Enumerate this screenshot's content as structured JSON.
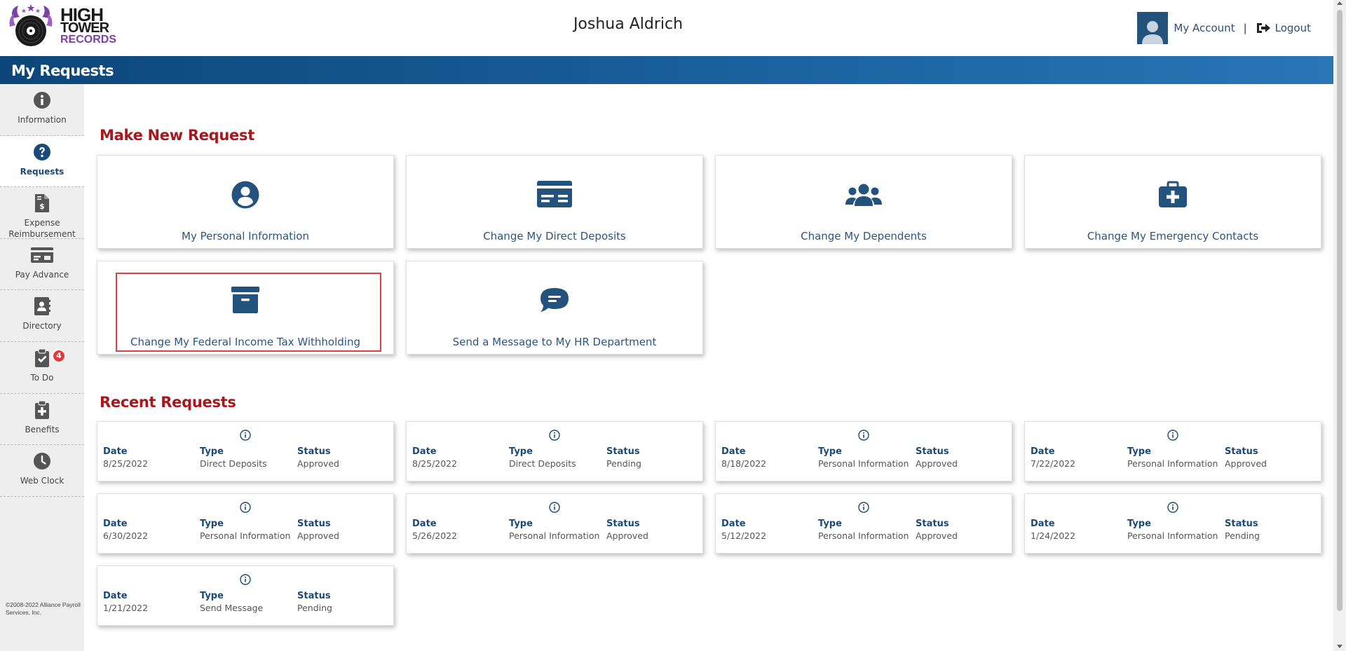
{
  "header": {
    "logo": {
      "line1": "HIGH",
      "line2": "TOWER",
      "line3": "RECORDS"
    },
    "user_name": "Joshua Aldrich",
    "my_account": "My Account",
    "separator": "|",
    "logout": "Logout"
  },
  "page_title": "My Requests",
  "sidebar": {
    "items": [
      {
        "label": "Information",
        "icon": "info-circle-icon"
      },
      {
        "label": "Requests",
        "icon": "question-circle-icon",
        "active": true
      },
      {
        "label": "Expense Reimbursement",
        "icon": "invoice-dollar-icon"
      },
      {
        "label": "Pay Advance",
        "icon": "money-check-icon"
      },
      {
        "label": "Directory",
        "icon": "address-book-icon"
      },
      {
        "label": "To Do",
        "icon": "clipboard-check-icon",
        "badge": "4"
      },
      {
        "label": "Benefits",
        "icon": "medical-clipboard-icon"
      },
      {
        "label": "Web Clock",
        "icon": "clock-icon"
      }
    ],
    "copyright": "©2008-2022 Alliance Payroll Services, Inc."
  },
  "make_new_request": {
    "title": "Make New Request",
    "cards": [
      {
        "label": "My Personal Information",
        "icon": "user-circle-icon"
      },
      {
        "label": "Change My Direct Deposits",
        "icon": "money-check-icon"
      },
      {
        "label": "Change My Dependents",
        "icon": "users-icon"
      },
      {
        "label": "Change My Emergency Contacts",
        "icon": "first-aid-kit-icon"
      },
      {
        "label": "Change My Federal Income Tax Withholding",
        "icon": "archive-box-icon"
      },
      {
        "label": "Send a Message to My HR Department",
        "icon": "comment-icon"
      }
    ]
  },
  "recent_requests": {
    "title": "Recent Requests",
    "headers": {
      "date": "Date",
      "type": "Type",
      "status": "Status"
    },
    "items": [
      {
        "date": "8/25/2022",
        "type": "Direct Deposits",
        "status": "Approved"
      },
      {
        "date": "8/25/2022",
        "type": "Direct Deposits",
        "status": "Pending"
      },
      {
        "date": "8/18/2022",
        "type": "Personal Information",
        "status": "Approved"
      },
      {
        "date": "7/22/2022",
        "type": "Personal Information",
        "status": "Approved"
      },
      {
        "date": "6/30/2022",
        "type": "Personal Information",
        "status": "Approved"
      },
      {
        "date": "5/26/2022",
        "type": "Personal Information",
        "status": "Approved"
      },
      {
        "date": "5/12/2022",
        "type": "Personal Information",
        "status": "Approved"
      },
      {
        "date": "1/24/2022",
        "type": "Personal Information",
        "status": "Pending"
      },
      {
        "date": "1/21/2022",
        "type": "Send Message",
        "status": "Pending"
      }
    ]
  },
  "colors": {
    "brand_blue": "#1c4a78",
    "icon_blue": "#23527c",
    "section_red": "#a8171c",
    "badge_red": "#e53935",
    "logo_purple": "#7b3fa6"
  }
}
